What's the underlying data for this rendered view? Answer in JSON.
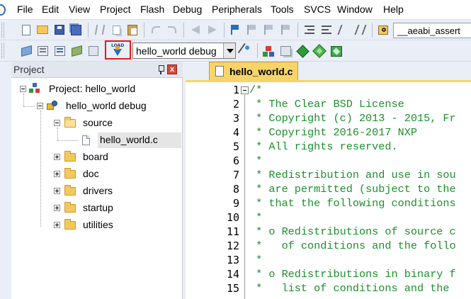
{
  "menubar": {
    "items": [
      "File",
      "Edit",
      "View",
      "Project",
      "Flash",
      "Debug",
      "Peripherals",
      "Tools",
      "SVCS",
      "Window",
      "Help"
    ]
  },
  "toolbar1": {
    "buttons": [
      "new-file-icon",
      "open-folder-icon",
      "save-icon",
      "save-all-icon",
      "cut-icon",
      "copy-icon",
      "paste-icon",
      "undo-icon",
      "redo-icon",
      "navigate-back-icon",
      "navigate-forward-icon",
      "bookmark-icon",
      "prev-bookmark-icon",
      "next-bookmark-icon",
      "clear-bookmarks-icon",
      "indent-icon",
      "unindent-icon",
      "comment-icon",
      "uncomment-icon",
      "find-in-files-icon"
    ],
    "search_value": "__aeabi_assert"
  },
  "toolbar2": {
    "buttons": [
      "translate-icon",
      "build-icon",
      "rebuild-icon",
      "batch-build-icon",
      "stop-build-icon",
      "load-icon",
      "target-options-icon",
      "manage-components-icon",
      "select-packs-icon",
      "pack-installer-icon",
      "run-time-env-icon"
    ],
    "load_label": "LOAD",
    "target_selected": "hello_world debug"
  },
  "project_panel": {
    "title": "Project",
    "close_label": "x",
    "tree": {
      "root": "Project: hello_world",
      "target": "hello_world debug",
      "groups": [
        "source",
        "board",
        "doc",
        "drivers",
        "startup",
        "utilities"
      ],
      "source_files": [
        "hello_world.c"
      ]
    }
  },
  "editor": {
    "tab_label": "hello_world.c",
    "line_numbers": [
      "1",
      "2",
      "3",
      "4",
      "5",
      "6",
      "7",
      "8",
      "9",
      "10",
      "11",
      "12",
      "13",
      "14",
      "15"
    ],
    "lines": [
      "/*",
      " * The Clear BSD License",
      " * Copyright (c) 2013 - 2015, Fr",
      " * Copyright 2016-2017 NXP",
      " * All rights reserved.",
      " *",
      " * Redistribution and use in sou",
      " * are permitted (subject to the",
      " * that the following conditions",
      " *",
      " * o Redistributions of source c",
      " *   of conditions and the follo",
      " *",
      " * o Redistributions in binary f",
      " *   list of conditions and the "
    ],
    "comment_color": "#1c8f2c",
    "tab_color": "#f7d469"
  },
  "colors": {
    "highlight_border": "#e01c1c",
    "toolbar_bg": "#eaeef6"
  }
}
